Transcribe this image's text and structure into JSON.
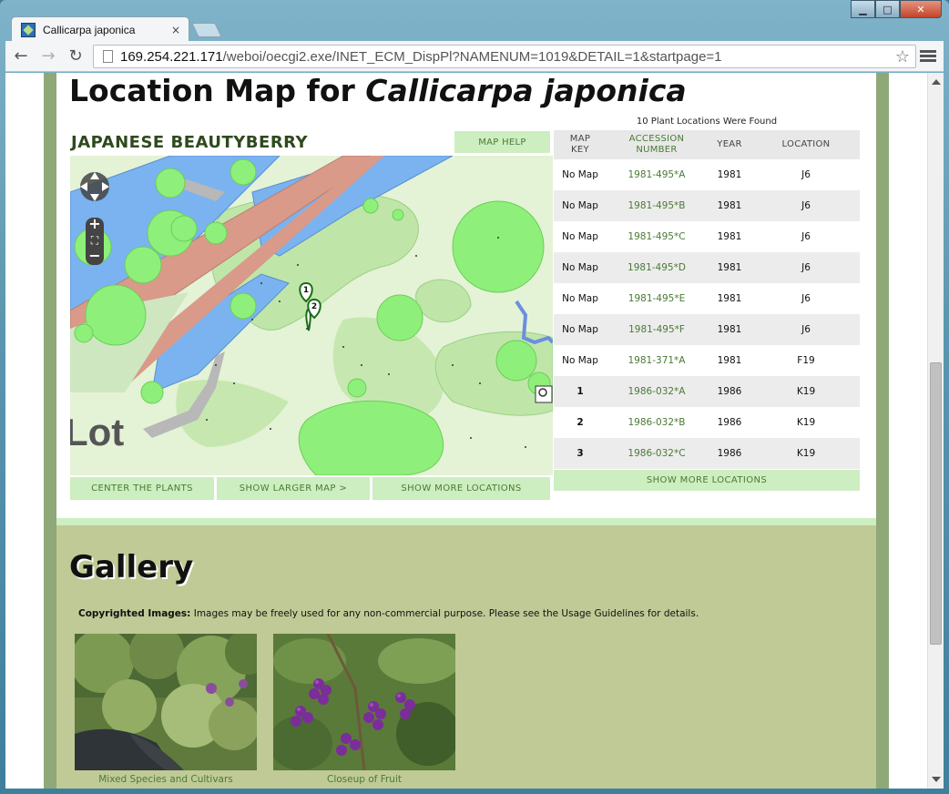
{
  "browser": {
    "tab_title": "Callicarpa japonica",
    "tab_close": "×",
    "url_host": "169.254.221.171",
    "url_rest": "/weboi/oecgi2.exe/INET_ECM_DispPl?NAMENUM=1019&DETAIL=1&startpage=1",
    "back_icon": "←",
    "forward_icon": "→",
    "reload_icon": "↻",
    "star_icon": "☆",
    "win_min": "▁",
    "win_max": "□",
    "win_close": "✕"
  },
  "location": {
    "heading_prefix": "Location Map for ",
    "heading_species": "Callicarpa japonica",
    "plant_common_name": "JAPANESE BEAUTYBERRY",
    "map_help": "MAP HELP",
    "found_text": "10 Plant Locations Were Found",
    "columns": {
      "map_key_1": "MAP",
      "map_key_2": "KEY",
      "accession_1": "ACCESSION",
      "accession_2": "NUMBER",
      "year": "YEAR",
      "location": "LOCATION"
    },
    "rows": [
      {
        "key": "No Map",
        "accession": "1981-495*A",
        "year": "1981",
        "location": "J6"
      },
      {
        "key": "No Map",
        "accession": "1981-495*B",
        "year": "1981",
        "location": "J6"
      },
      {
        "key": "No Map",
        "accession": "1981-495*C",
        "year": "1981",
        "location": "J6"
      },
      {
        "key": "No Map",
        "accession": "1981-495*D",
        "year": "1981",
        "location": "J6"
      },
      {
        "key": "No Map",
        "accession": "1981-495*E",
        "year": "1981",
        "location": "J6"
      },
      {
        "key": "No Map",
        "accession": "1981-495*F",
        "year": "1981",
        "location": "J6"
      },
      {
        "key": "No Map",
        "accession": "1981-371*A",
        "year": "1981",
        "location": "F19"
      },
      {
        "key": "1",
        "accession": "1986-032*A",
        "year": "1986",
        "location": "K19"
      },
      {
        "key": "2",
        "accession": "1986-032*B",
        "year": "1986",
        "location": "K19"
      },
      {
        "key": "3",
        "accession": "1986-032*C",
        "year": "1986",
        "location": "K19"
      }
    ],
    "show_more_locations_table": "SHOW MORE LOCATIONS",
    "buttons": {
      "center": "CENTER THE PLANTS",
      "larger": "SHOW LARGER MAP >",
      "more": "SHOW MORE LOCATIONS"
    },
    "map": {
      "lot_text": "Lot",
      "marker_1": "1",
      "marker_2": "2",
      "zoom_in": "+",
      "zoom_out": "−",
      "fullscreen": "⛶"
    }
  },
  "gallery": {
    "title": "Gallery",
    "copyright_label": "Copyrighted Images:",
    "copyright_text": " Images may be freely used for any non-commercial purpose. Please see the Usage Guidelines for details.",
    "images": [
      {
        "caption": "Mixed Species and Cultivars"
      },
      {
        "caption": "Closeup of Fruit"
      }
    ]
  },
  "colors": {
    "accent_green": "#4a7a35",
    "button_green": "#cdeec0",
    "frame_green": "#8fa878",
    "gallery_bg": "#bfca96"
  }
}
